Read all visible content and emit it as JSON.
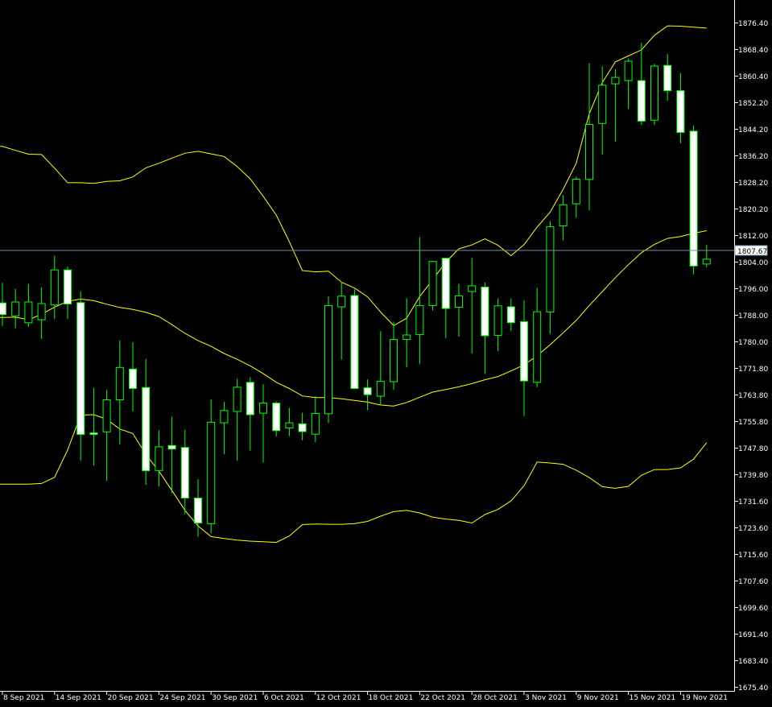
{
  "colors": {
    "background": "#000000",
    "axis": "#ffffff",
    "wick": "#00ff00",
    "bull_body": "#000000",
    "bear_body": "#ffffff",
    "band": "#ffff00",
    "current_line": "#6f8fa8"
  },
  "chart_data": {
    "type": "candlestick",
    "ylim": [
      1675.4,
      1880.4
    ],
    "grid": false,
    "current_price": "1807.67",
    "y_ticks": [
      "1876.40",
      "1868.40",
      "1860.40",
      "1852.20",
      "1844.20",
      "1836.20",
      "1828.20",
      "1820.20",
      "1812.00",
      "1804.00",
      "1796.00",
      "1788.00",
      "1780.00",
      "1771.80",
      "1763.80",
      "1755.80",
      "1747.80",
      "1739.80",
      "1731.60",
      "1723.60",
      "1715.60",
      "1707.60",
      "1699.60",
      "1691.40",
      "1683.40",
      "1675.40"
    ],
    "x_labels": [
      {
        "index": 0,
        "label": "8 Sep 2021"
      },
      {
        "index": 4,
        "label": "14 Sep 2021"
      },
      {
        "index": 8,
        "label": "20 Sep 2021"
      },
      {
        "index": 12,
        "label": "24 Sep 2021"
      },
      {
        "index": 16,
        "label": "30 Sep 2021"
      },
      {
        "index": 20,
        "label": "6 Oct 2021"
      },
      {
        "index": 24,
        "label": "12 Oct 2021"
      },
      {
        "index": 28,
        "label": "18 Oct 2021"
      },
      {
        "index": 32,
        "label": "22 Oct 2021"
      },
      {
        "index": 36,
        "label": "28 Oct 2021"
      },
      {
        "index": 40,
        "label": "3 Nov 2021"
      },
      {
        "index": 44,
        "label": "9 Nov 2021"
      },
      {
        "index": 48,
        "label": "15 Nov 2021"
      },
      {
        "index": 52,
        "label": "19 Nov 2021"
      }
    ],
    "candles": [
      {
        "o": 1794.0,
        "h": 1800.2,
        "l": 1786.9,
        "c": 1790.4
      },
      {
        "o": 1790.0,
        "h": 1798.4,
        "l": 1786.2,
        "c": 1794.3
      },
      {
        "o": 1787.9,
        "h": 1799.9,
        "l": 1786.7,
        "c": 1794.3
      },
      {
        "o": 1788.8,
        "h": 1798.8,
        "l": 1782.9,
        "c": 1793.8
      },
      {
        "o": 1793.4,
        "h": 1808.6,
        "l": 1789.0,
        "c": 1804.2
      },
      {
        "o": 1804.2,
        "h": 1805.2,
        "l": 1789.0,
        "c": 1793.7
      },
      {
        "o": 1794.1,
        "h": 1797.6,
        "l": 1745.3,
        "c": 1753.4
      },
      {
        "o": 1753.9,
        "h": 1767.8,
        "l": 1743.8,
        "c": 1753.8
      },
      {
        "o": 1754.2,
        "h": 1767.1,
        "l": 1739.1,
        "c": 1764.1
      },
      {
        "o": 1764.1,
        "h": 1782.4,
        "l": 1750.4,
        "c": 1774.1
      },
      {
        "o": 1773.6,
        "h": 1781.9,
        "l": 1760.5,
        "c": 1767.6
      },
      {
        "o": 1767.9,
        "h": 1776.7,
        "l": 1737.9,
        "c": 1742.2
      },
      {
        "o": 1742.3,
        "h": 1754.7,
        "l": 1737.3,
        "c": 1749.6
      },
      {
        "o": 1750.0,
        "h": 1758.9,
        "l": 1735.3,
        "c": 1748.9
      },
      {
        "o": 1749.4,
        "h": 1754.9,
        "l": 1728.8,
        "c": 1733.8
      },
      {
        "o": 1733.8,
        "h": 1739.6,
        "l": 1721.8,
        "c": 1726.1
      },
      {
        "o": 1725.9,
        "h": 1764.2,
        "l": 1722.9,
        "c": 1757.2
      },
      {
        "o": 1757.0,
        "h": 1763.5,
        "l": 1747.3,
        "c": 1760.8
      },
      {
        "o": 1760.5,
        "h": 1770.6,
        "l": 1745.3,
        "c": 1768.0
      },
      {
        "o": 1769.5,
        "h": 1771.1,
        "l": 1748.4,
        "c": 1759.5
      },
      {
        "o": 1760.0,
        "h": 1768.9,
        "l": 1744.8,
        "c": 1763.1
      },
      {
        "o": 1763.1,
        "h": 1763.6,
        "l": 1752.8,
        "c": 1754.6
      },
      {
        "o": 1755.4,
        "h": 1761.6,
        "l": 1752.9,
        "c": 1757.0
      },
      {
        "o": 1756.7,
        "h": 1760.1,
        "l": 1751.6,
        "c": 1754.3
      },
      {
        "o": 1753.5,
        "h": 1765.2,
        "l": 1751.1,
        "c": 1759.9
      },
      {
        "o": 1759.8,
        "h": 1796.1,
        "l": 1757.0,
        "c": 1793.2
      },
      {
        "o": 1792.8,
        "h": 1800.5,
        "l": 1776.5,
        "c": 1796.1
      },
      {
        "o": 1796.3,
        "h": 1798.2,
        "l": 1767.5,
        "c": 1767.6
      },
      {
        "o": 1767.8,
        "h": 1770.4,
        "l": 1760.9,
        "c": 1765.7
      },
      {
        "o": 1765.2,
        "h": 1785.3,
        "l": 1762.4,
        "c": 1769.8
      },
      {
        "o": 1769.7,
        "h": 1788.2,
        "l": 1767.2,
        "c": 1782.7
      },
      {
        "o": 1782.7,
        "h": 1795.5,
        "l": 1774.1,
        "c": 1784.1
      },
      {
        "o": 1784.2,
        "h": 1814.3,
        "l": 1775.1,
        "c": 1793.2
      },
      {
        "o": 1793.2,
        "h": 1807.0,
        "l": 1791.7,
        "c": 1806.8
      },
      {
        "o": 1807.8,
        "h": 1807.9,
        "l": 1783.2,
        "c": 1792.3
      },
      {
        "o": 1792.7,
        "h": 1799.9,
        "l": 1783.6,
        "c": 1796.2
      },
      {
        "o": 1797.5,
        "h": 1807.9,
        "l": 1778.4,
        "c": 1799.3
      },
      {
        "o": 1798.9,
        "h": 1800.3,
        "l": 1772.1,
        "c": 1783.9
      },
      {
        "o": 1784.0,
        "h": 1795.4,
        "l": 1779.1,
        "c": 1793.1
      },
      {
        "o": 1792.8,
        "h": 1795.4,
        "l": 1785.4,
        "c": 1787.9
      },
      {
        "o": 1788.2,
        "h": 1794.8,
        "l": 1759.1,
        "c": 1769.9
      },
      {
        "o": 1769.5,
        "h": 1798.7,
        "l": 1768.0,
        "c": 1791.3
      },
      {
        "o": 1791.2,
        "h": 1819.3,
        "l": 1784.4,
        "c": 1817.5
      },
      {
        "o": 1817.8,
        "h": 1827.3,
        "l": 1813.3,
        "c": 1824.3
      },
      {
        "o": 1824.6,
        "h": 1833.0,
        "l": 1820.3,
        "c": 1832.2
      },
      {
        "o": 1832.1,
        "h": 1868.0,
        "l": 1822.6,
        "c": 1849.1
      },
      {
        "o": 1849.4,
        "h": 1867.0,
        "l": 1839.8,
        "c": 1861.2
      },
      {
        "o": 1861.6,
        "h": 1866.1,
        "l": 1843.7,
        "c": 1863.6
      },
      {
        "o": 1862.6,
        "h": 1869.4,
        "l": 1853.8,
        "c": 1868.6
      },
      {
        "o": 1862.6,
        "h": 1874.3,
        "l": 1848.9,
        "c": 1850.1
      },
      {
        "o": 1850.4,
        "h": 1867.8,
        "l": 1848.9,
        "c": 1867.1
      },
      {
        "o": 1867.3,
        "h": 1870.8,
        "l": 1856.4,
        "c": 1859.5
      },
      {
        "o": 1859.5,
        "h": 1864.9,
        "l": 1843.3,
        "c": 1846.6
      },
      {
        "o": 1847.0,
        "h": 1848.8,
        "l": 1802.8,
        "c": 1805.4
      },
      {
        "o": 1806.0,
        "h": 1812.0,
        "l": 1805.0,
        "c": 1807.5
      }
    ],
    "bands": {
      "upper": [
        1842.3,
        1841.1,
        1839.9,
        1839.8,
        1835.6,
        1831.1,
        1831.1,
        1830.9,
        1831.5,
        1831.7,
        1832.9,
        1835.7,
        1837.1,
        1838.7,
        1840.2,
        1840.8,
        1840.0,
        1839.2,
        1836.1,
        1832.3,
        1826.9,
        1821.1,
        1812.9,
        1804.0,
        1803.6,
        1803.8,
        1800.4,
        1798.6,
        1795.9,
        1791.2,
        1787.0,
        1789.3,
        1796.0,
        1801.2,
        1806.6,
        1810.7,
        1811.9,
        1813.8,
        1811.8,
        1808.6,
        1812.0,
        1817.4,
        1822.0,
        1829.1,
        1837.1,
        1852.4,
        1862.0,
        1868.4,
        1870.2,
        1872.1,
        1876.6,
        1879.5,
        1879.4,
        1879.1,
        1878.8
      ],
      "middle": [
        1789.5,
        1789.6,
        1788.8,
        1790.5,
        1792.7,
        1794.5,
        1795.2,
        1794.7,
        1793.6,
        1792.6,
        1792.0,
        1791.1,
        1789.8,
        1787.3,
        1784.6,
        1782.4,
        1780.6,
        1778.4,
        1776.6,
        1774.6,
        1772.2,
        1769.5,
        1767.6,
        1765.3,
        1764.8,
        1764.8,
        1764.4,
        1763.9,
        1763.4,
        1762.5,
        1762.2,
        1763.3,
        1764.9,
        1766.5,
        1767.3,
        1768.1,
        1769.1,
        1770.3,
        1771.3,
        1773.0,
        1774.9,
        1777.7,
        1781.1,
        1784.8,
        1788.6,
        1793.2,
        1797.5,
        1801.8,
        1805.8,
        1809.5,
        1812.1,
        1813.9,
        1814.5,
        1815.5,
        1816.3
      ],
      "lower": [
        1738.1,
        1738.1,
        1738.1,
        1738.3,
        1740.2,
        1748.6,
        1759.4,
        1759.5,
        1758.1,
        1755.1,
        1753.7,
        1747.2,
        1742.1,
        1736.1,
        1730.0,
        1725.2,
        1721.9,
        1721.3,
        1720.8,
        1720.5,
        1720.3,
        1720.1,
        1722.1,
        1725.6,
        1725.8,
        1725.7,
        1725.7,
        1725.9,
        1726.6,
        1728.2,
        1729.6,
        1730.0,
        1729.2,
        1727.9,
        1727.3,
        1726.9,
        1726.1,
        1728.7,
        1730.3,
        1732.9,
        1737.6,
        1744.9,
        1744.6,
        1744.2,
        1742.4,
        1740.1,
        1737.3,
        1736.8,
        1737.4,
        1740.8,
        1742.6,
        1742.6,
        1743.1,
        1745.8,
        1750.9
      ]
    }
  }
}
